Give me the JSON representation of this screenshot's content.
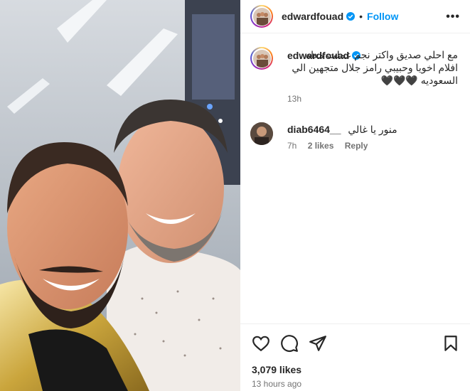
{
  "post": {
    "username": "edwardfouad",
    "separator": "•",
    "follow_label": "Follow",
    "more_label": "•••"
  },
  "caption": {
    "username": "edwardfouad",
    "text": "مع احلي صديق واكتر نجم عملت معاه افلام اخويا وحبيبي رامز جلال متجهين الي السعوديه 🖤🖤🖤",
    "time": "13h"
  },
  "comment": {
    "username": "diab6464__",
    "text": "منور يا غالي",
    "time": "7h",
    "likes": "2 likes",
    "reply_label": "Reply"
  },
  "footer": {
    "likes": "3,079 likes",
    "time_ago": "13 hours ago"
  },
  "icons": [
    "heart-icon",
    "comment-icon",
    "share-icon",
    "bookmark-icon",
    "verified-badge-icon",
    "more-options-icon"
  ],
  "colors": {
    "accent": "#0095f6",
    "verified": "#0095f6",
    "muted": "#737373"
  }
}
